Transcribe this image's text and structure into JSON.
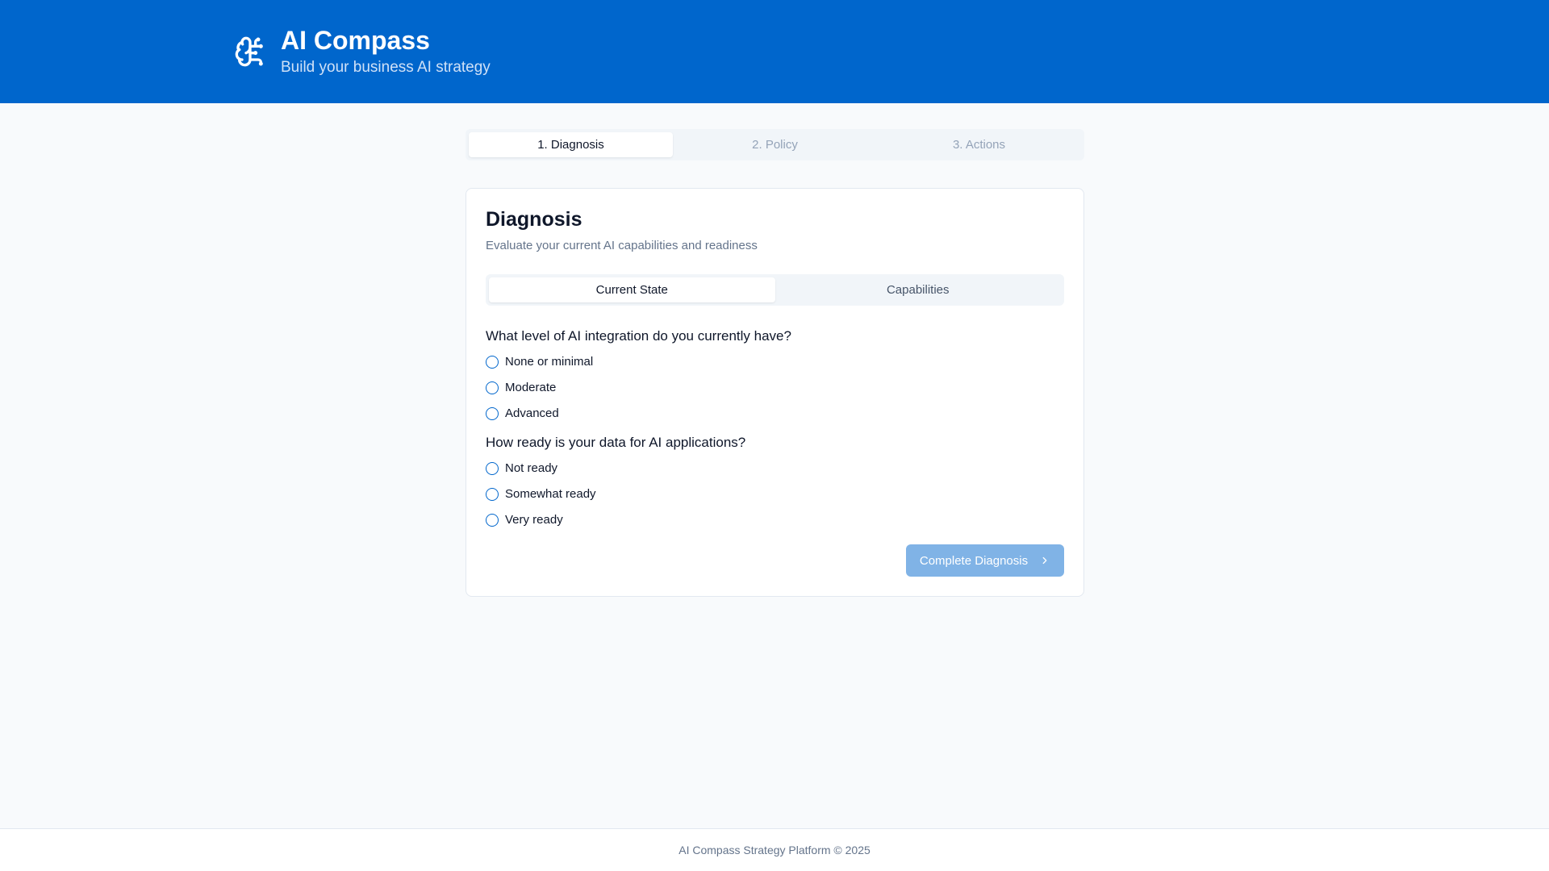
{
  "header": {
    "icon": "brain-icon",
    "title": "AI Compass",
    "subtitle": "Build your business AI strategy",
    "background": "#0066cc"
  },
  "steps": [
    {
      "label": "1. Diagnosis",
      "active": true
    },
    {
      "label": "2. Policy",
      "active": false
    },
    {
      "label": "3. Actions",
      "active": false
    }
  ],
  "card": {
    "title": "Diagnosis",
    "description": "Evaluate your current AI capabilities and readiness",
    "tabs": [
      {
        "label": "Current State",
        "active": true
      },
      {
        "label": "Capabilities",
        "active": false
      }
    ],
    "questions": [
      {
        "text": "What level of AI integration do you currently have?",
        "options": [
          "None or minimal",
          "Moderate",
          "Advanced"
        ]
      },
      {
        "text": "How ready is your data for AI applications?",
        "options": [
          "Not ready",
          "Somewhat ready",
          "Very ready"
        ]
      }
    ],
    "submit_label": "Complete Diagnosis",
    "submit_icon": "chevron-right-icon"
  },
  "footer": {
    "text": "AI Compass Strategy Platform © 2025"
  }
}
